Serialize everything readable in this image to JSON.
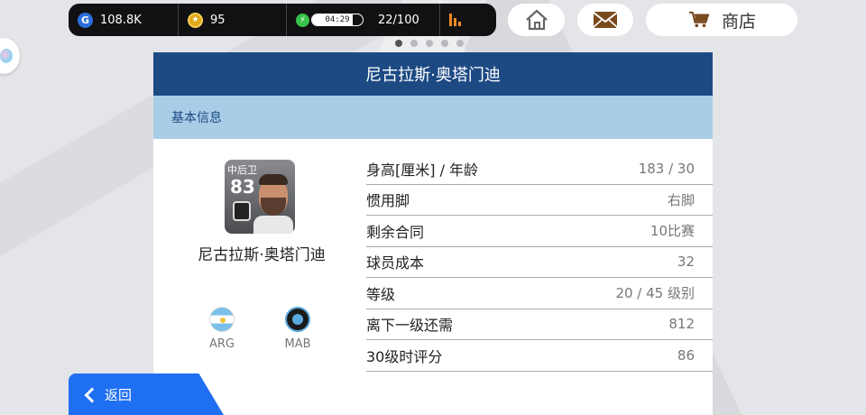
{
  "topbar": {
    "gp_icon": "G",
    "gp_value": "108.8K",
    "coins_value": "95",
    "energy_time": "04:29",
    "energy_level": 0.8,
    "energy_count": "22/100",
    "colors": {
      "gp": "#2a6fdb",
      "coin": "#e0a918",
      "energy": "#39c24a",
      "signal": "#f08a24"
    }
  },
  "nav": {
    "home_icon": "home-icon",
    "mail_icon": "mail-icon",
    "shop_label": "商店",
    "shop_icon": "cart-icon"
  },
  "pager": {
    "pages": 5,
    "active": 0
  },
  "panel": {
    "title": "尼古拉斯·奥塔门迪",
    "section": "基本信息",
    "colors": {
      "header": "#1e4a84",
      "sub": "#a9cde6"
    }
  },
  "player": {
    "position": "中后卫",
    "rating": "83",
    "name": "尼古拉斯·奥塔门迪",
    "nationality": "ARG",
    "club": "MAB"
  },
  "stats": [
    {
      "label": "身高[厘米] / 年龄",
      "value": "183 / 30"
    },
    {
      "label": "惯用脚",
      "value": "右脚"
    },
    {
      "label": "剩余合同",
      "value": "10比赛"
    },
    {
      "label": "球员成本",
      "value": "32"
    },
    {
      "label": "等级",
      "value": "20 / 45 级别"
    },
    {
      "label": "离下一级还需",
      "value": "812"
    },
    {
      "label": "30级时评分",
      "value": "86"
    }
  ],
  "back": {
    "label": "返回",
    "color": "#1f6ff2"
  }
}
